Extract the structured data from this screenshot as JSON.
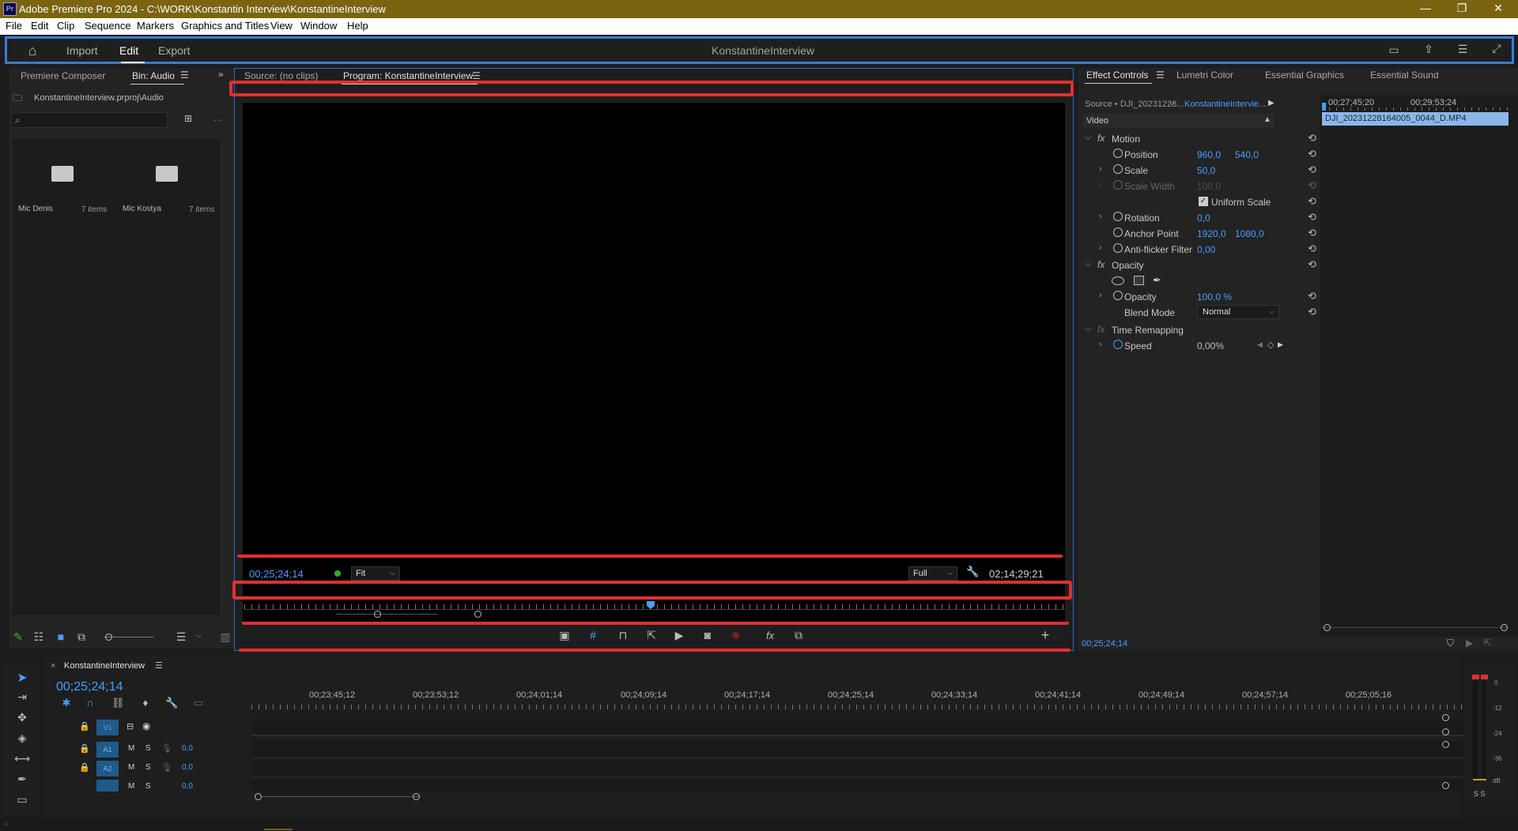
{
  "window": {
    "title": "Adobe Premiere Pro 2024 - C:\\WORK\\Konstantin Interview\\KonstantineInterview",
    "app_badge": "Pr",
    "minimize": "—",
    "restore": "❐",
    "close": "✕"
  },
  "menu": [
    "File",
    "Edit",
    "Clip",
    "Sequence",
    "Markers",
    "Graphics and Titles",
    "View",
    "Window",
    "Help"
  ],
  "workspace": {
    "tabs": [
      "Import",
      "Edit",
      "Export"
    ],
    "active": "Edit",
    "project_name": "KonstantineInterview"
  },
  "project_panel": {
    "tabs": [
      "Premiere Composer",
      "Bin: Audio"
    ],
    "path": "KonstantineInterview.prproj\\Audio",
    "items": [
      {
        "name": "Mic Denis",
        "count": "7 items"
      },
      {
        "name": "Mic Kostya",
        "count": "7 items"
      }
    ]
  },
  "monitor": {
    "source_tab": "Source: (no clips)",
    "program_tab": "Program: KonstantineInterview",
    "timecode_current": "00;25;24;14",
    "fit": "Fit",
    "quality": "Full",
    "timecode_duration": "02;14;29;21",
    "fx_label": "fx"
  },
  "effect_controls": {
    "tabs": [
      "Effect Controls",
      "Lumetri Color",
      "Essential Graphics",
      "Essential Sound"
    ],
    "source": "Source • DJI_20231228...",
    "sequence": "KonstantineIntervie...",
    "time_start": "00;27;45;20",
    "time_end": "00;29;53;24",
    "clip_name": "DJI_20231228164005_0044_D.MP4",
    "section": "Video",
    "motion": "Motion",
    "position_label": "Position",
    "position_x": "960,0",
    "position_y": "540,0",
    "scale_label": "Scale",
    "scale": "50,0",
    "scale_width_label": "Scale Width",
    "scale_width": "100,0",
    "uniform_scale": "Uniform Scale",
    "rotation_label": "Rotation",
    "rotation": "0,0",
    "anchor_label": "Anchor Point",
    "anchor_x": "1920,0",
    "anchor_y": "1080,0",
    "antiflicker_label": "Anti-flicker Filter",
    "antiflicker": "0,00",
    "opacity_section": "Opacity",
    "opacity_label": "Opacity",
    "opacity": "100,0 %",
    "blend_label": "Blend Mode",
    "blend": "Normal",
    "time_remap": "Time Remapping",
    "speed_label": "Speed",
    "speed": "0,00%",
    "timecode": "00;25;24;14",
    "fx_label": "fx"
  },
  "timeline": {
    "tab": "KonstantineInterview",
    "timecode": "00;25;24;14",
    "ruler": [
      "00;23;45;12",
      "00;23;53;12",
      "00;24;01;14",
      "00;24;09;14",
      "00;24;17;14",
      "00;24;25;14",
      "00;24;33;14",
      "00;24;41;14",
      "00;24;49;14",
      "00;24;57;14",
      "00;25;05;16"
    ],
    "tracks": [
      {
        "id": "V1",
        "m": "",
        "s": "",
        "vol": ""
      },
      {
        "id": "A1",
        "m": "M",
        "s": "S",
        "vol": "0,0"
      },
      {
        "id": "A2",
        "m": "M",
        "s": "S",
        "vol": "0,0"
      },
      {
        "id": "",
        "m": "M",
        "s": "S",
        "vol": "0,0"
      }
    ],
    "v1_dim": "V1"
  },
  "meter": {
    "scale": [
      "0",
      "-12",
      "-24",
      "-36",
      "dB"
    ],
    "solo": "S S"
  },
  "colors": {
    "accent": "#4a9eff",
    "highlight": "#e03030",
    "workspace_border": "#3a7bd5",
    "titlebar": "#7a6410"
  }
}
